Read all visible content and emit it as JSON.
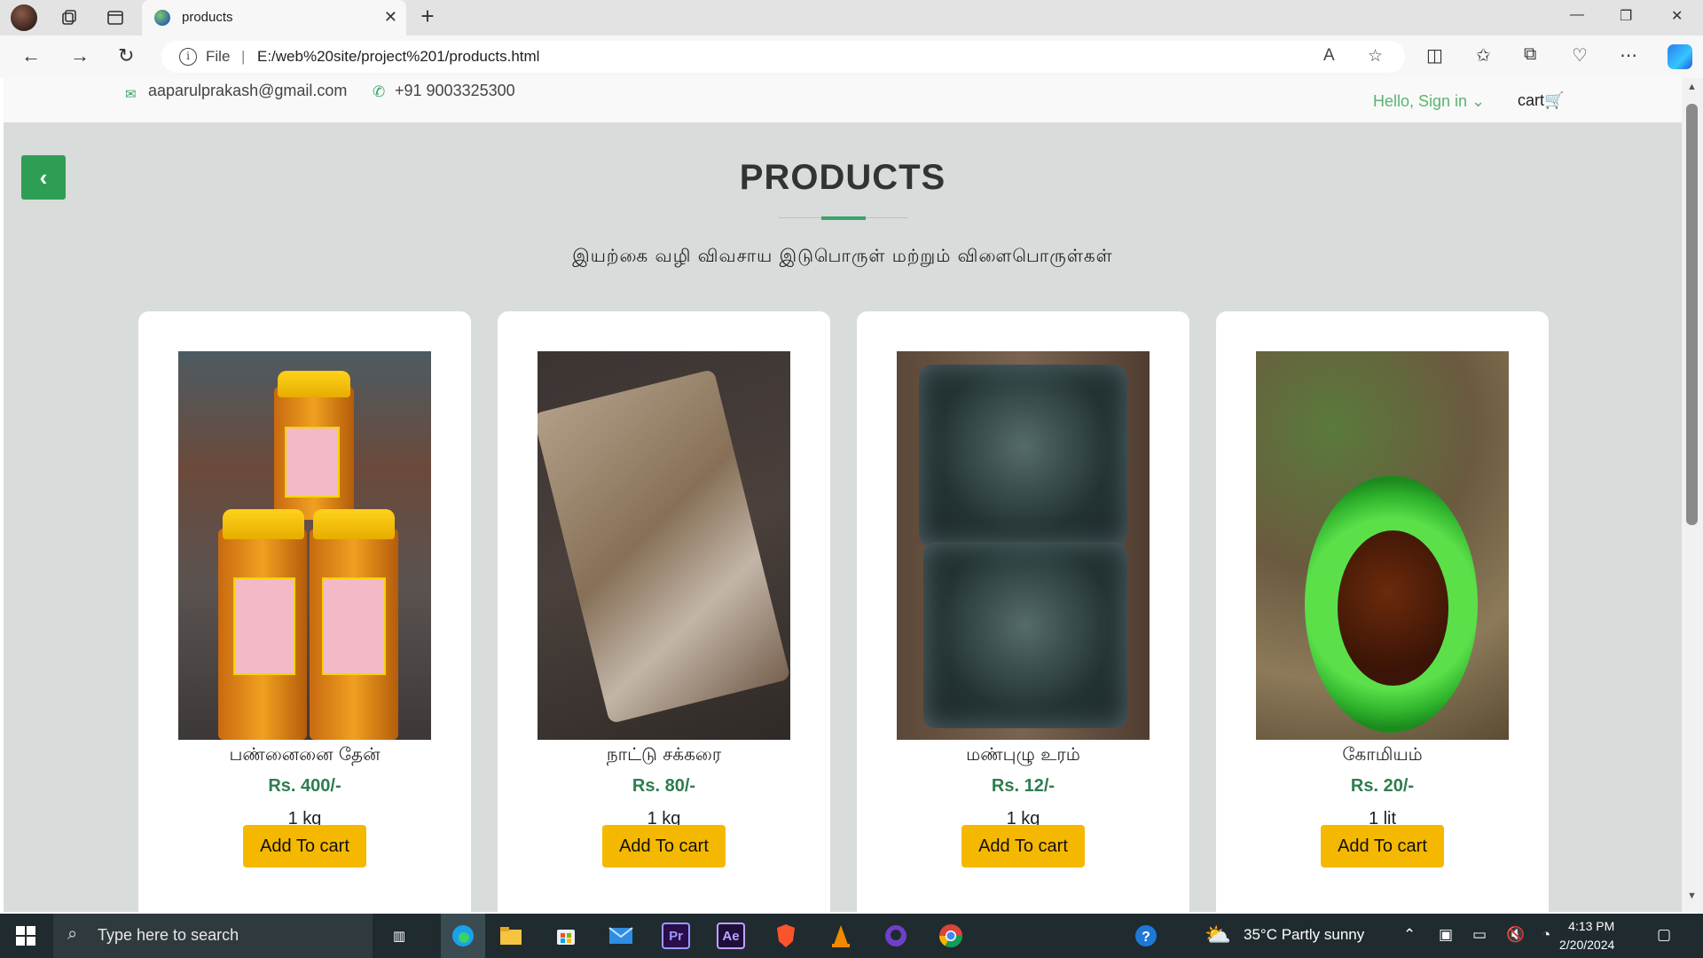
{
  "browser": {
    "tab_title": "products",
    "file_label": "File",
    "separator": "|",
    "url": "E:/web%20site/project%201/products.html"
  },
  "topbar": {
    "email": "aaparulprakash@gmail.com",
    "phone": "+91 9003325300",
    "signin": "Hello, Sign in ⌄",
    "cart": "cart🛒"
  },
  "page": {
    "back_glyph": "‹",
    "title": "PRODUCTS",
    "subtitle": "இயற்கை வழி விவசாய இடுபொருள் மற்றும் விளைபொருள்கள்"
  },
  "products": [
    {
      "name": "பண்னைனை தேன்",
      "price": "Rs. 400/-",
      "qty": "1 kg",
      "button": "Add To cart"
    },
    {
      "name": "நாட்டு சக்கரை",
      "price": "Rs. 80/-",
      "qty": "1 kg",
      "button": "Add To cart"
    },
    {
      "name": "மண்புழு உரம்",
      "price": "Rs. 12/-",
      "qty": "1 kg",
      "button": "Add To cart"
    },
    {
      "name": "கோமியம்",
      "price": "Rs. 20/-",
      "qty": "1 lit",
      "button": "Add To cart"
    }
  ],
  "taskbar": {
    "search_placeholder": "Type here to search",
    "weather": "35°C  Partly sunny",
    "time": "4:13 PM",
    "date": "2/20/2024",
    "apps": [
      "Pr",
      "Ae"
    ]
  },
  "colors": {
    "accent_green": "#3aa26a",
    "button_yellow": "#f5b800",
    "price_green": "#2e7d4f"
  }
}
